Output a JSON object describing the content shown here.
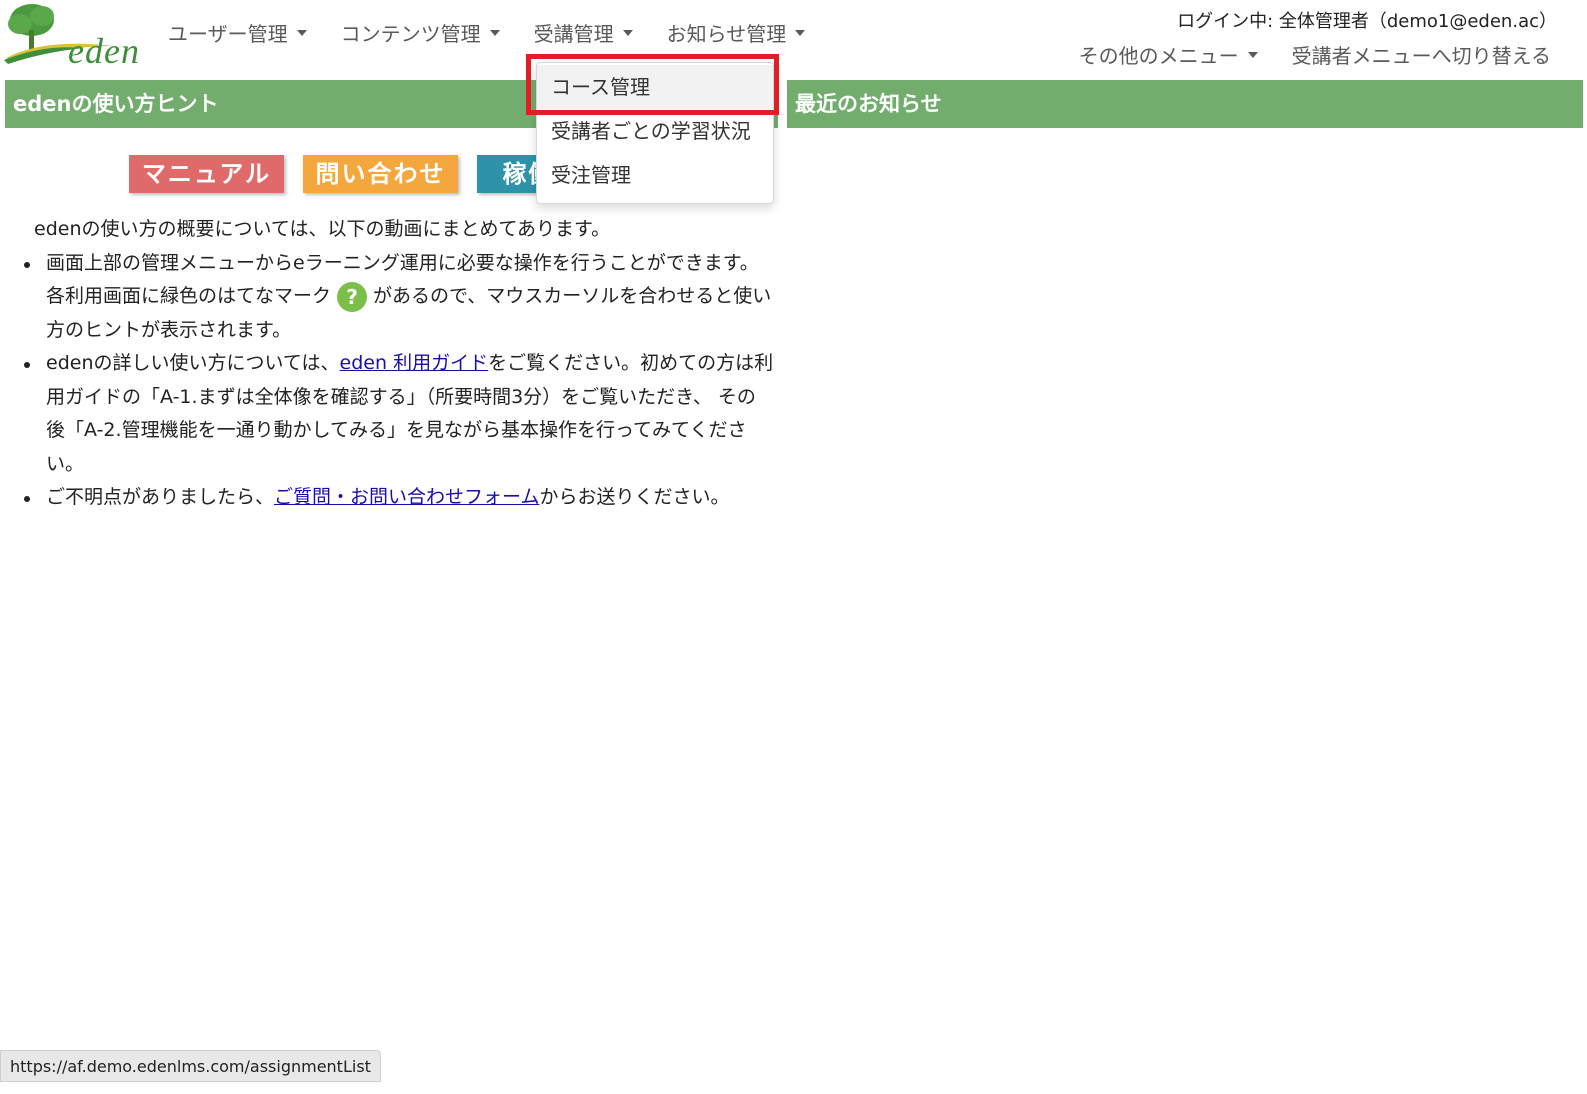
{
  "header": {
    "logo_text": "eden",
    "nav": [
      {
        "label": "ユーザー管理"
      },
      {
        "label": "コンテンツ管理"
      },
      {
        "label": "受講管理"
      },
      {
        "label": "お知らせ管理"
      }
    ],
    "login_info": "ログイン中: 全体管理者（demo1@eden.ac）",
    "other_menu": "その他のメニュー",
    "switch_menu": "受講者メニューへ切り替える"
  },
  "dropdown": {
    "items": [
      {
        "label": "コース管理"
      },
      {
        "label": "受講者ごとの学習状況"
      },
      {
        "label": "受注管理"
      }
    ]
  },
  "left_panel": {
    "title": "edenの使い方ヒント",
    "banners": {
      "manual": "マニュアル",
      "contact": "問い合わせ",
      "status": "稼働状況"
    },
    "intro": "edenの使い方の概要については、以下の動画にまとめてあります。",
    "bullet1_a": "画面上部の管理メニューからeラーニング運用に必要な操作を行うことができます。各利用画面に緑色のはてなマーク",
    "bullet1_icon": "?",
    "bullet1_b": "があるので、マウスカーソルを合わせると使い方のヒントが表示されます。",
    "bullet2_a": "edenの詳しい使い方については、",
    "bullet2_link": "eden 利用ガイド",
    "bullet2_b": "をご覧ください。初めての方は利用ガイドの「A-1.まずは全体像を確認する」（所要時間3分）をご覧いただき、 その後「A-2.管理機能を一通り動かしてみる」を見ながら基本操作を行ってみてください。",
    "bullet3_a": "ご不明点がありましたら、",
    "bullet3_link": "ご質問・お問い合わせフォーム",
    "bullet3_b": "からお送りください。"
  },
  "right_panel": {
    "title": "最近のお知らせ"
  },
  "status_bar": {
    "url": "https://af.demo.edenlms.com/assignmentList"
  },
  "colors": {
    "brand_green": "#72ad6e",
    "highlight_red": "#e01e26"
  }
}
